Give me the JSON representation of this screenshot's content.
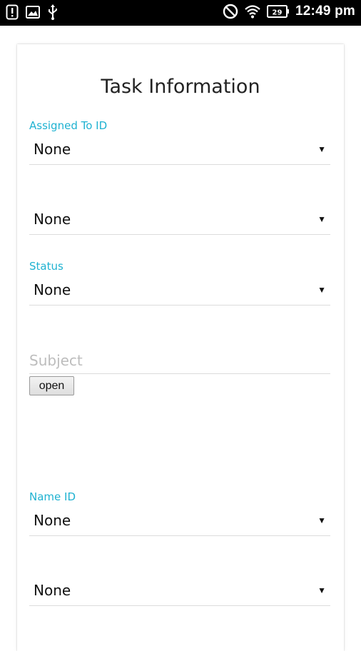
{
  "status_bar": {
    "time": "12:49 pm",
    "battery_level": "29",
    "left_icons": [
      "alert-icon",
      "image-icon",
      "usb-icon"
    ],
    "right_icons": [
      "do-not-disturb-icon",
      "wifi-icon",
      "battery-icon"
    ]
  },
  "form": {
    "title": "Task Information",
    "assigned_to": {
      "label": "Assigned To ID",
      "value": "None"
    },
    "unlabeled_select_1": {
      "value": "None"
    },
    "status": {
      "label": "Status",
      "value": "None"
    },
    "subject": {
      "placeholder": "Subject",
      "value": ""
    },
    "open_button": "open",
    "name_id": {
      "label": "Name ID",
      "value": "None"
    },
    "unlabeled_select_2": {
      "value": "None"
    }
  },
  "colors": {
    "label_accent": "#1fb2d1",
    "status_bar_bg": "#000000",
    "divider": "#dcdcdc"
  }
}
